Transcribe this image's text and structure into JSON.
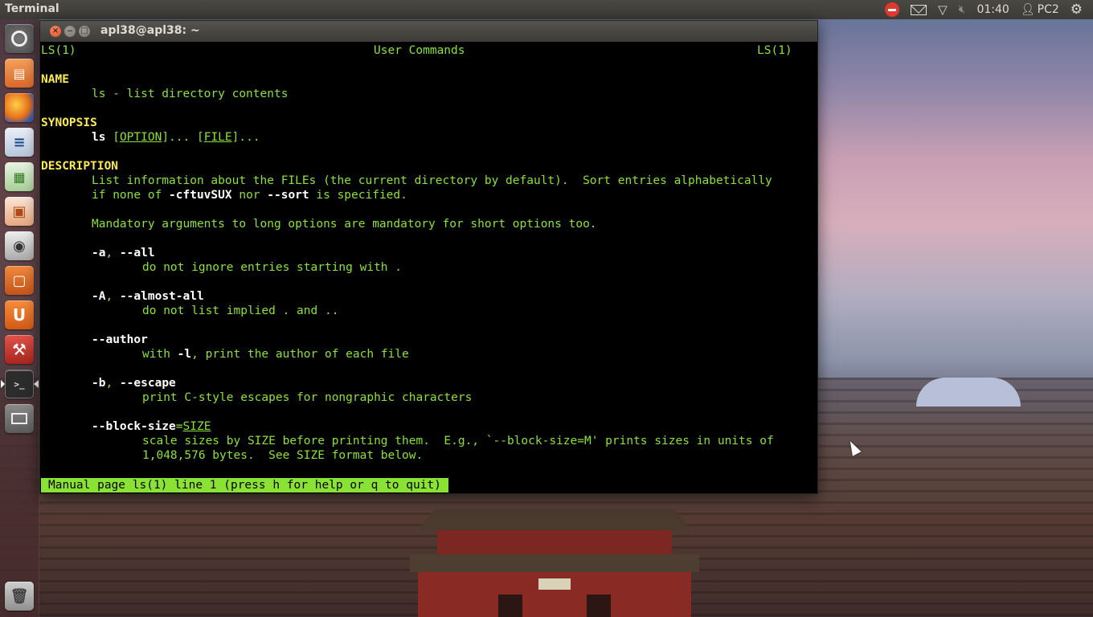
{
  "top_panel": {
    "app_title": "Terminal",
    "clock": "01:40",
    "user": "PC2",
    "icons": [
      "stop-icon",
      "mail-icon",
      "wifi-icon",
      "volume-muted-icon",
      "user-icon",
      "gear-icon"
    ]
  },
  "launcher": {
    "items": [
      {
        "name": "dash",
        "icon": "ubuntu-logo-icon"
      },
      {
        "name": "files",
        "icon": "folder-icon"
      },
      {
        "name": "firefox",
        "icon": "firefox-icon"
      },
      {
        "name": "writer",
        "icon": "libreoffice-writer-icon"
      },
      {
        "name": "calc",
        "icon": "libreoffice-calc-icon"
      },
      {
        "name": "impress",
        "icon": "libreoffice-impress-icon"
      },
      {
        "name": "camera",
        "icon": "camera-icon"
      },
      {
        "name": "software-center",
        "icon": "shopping-bag-icon"
      },
      {
        "name": "ubuntu-one",
        "icon": "ubuntu-one-icon"
      },
      {
        "name": "system-settings",
        "icon": "settings-icon"
      },
      {
        "name": "terminal",
        "icon": "terminal-icon"
      },
      {
        "name": "workspace-switcher",
        "icon": "workspace-icon"
      },
      {
        "name": "trash",
        "icon": "trash-icon"
      }
    ]
  },
  "window": {
    "title": "apl38@apl38: ~"
  },
  "man": {
    "header_left": "LS(1)",
    "header_center": "User Commands",
    "header_right": "LS(1)",
    "name_heading": "NAME",
    "name_text": "ls - list directory contents",
    "synopsis_heading": "SYNOPSIS",
    "synopsis_cmd": "ls",
    "synopsis_opt1_pre": " [",
    "synopsis_option": "OPTION",
    "synopsis_opt1_post": "]... [",
    "synopsis_file": "FILE",
    "synopsis_opt2_post": "]...",
    "description_heading": "DESCRIPTION",
    "desc_line1": "List information about the FILEs (the current directory by default).  Sort entries alphabetically",
    "desc_line2_a": "if none of ",
    "desc_line2_b": "-cftuvSUX",
    "desc_line2_c": " nor ",
    "desc_line2_d": "--sort",
    "desc_line2_e": " is specified.",
    "mandatory": "Mandatory arguments to long options are mandatory for short options too.",
    "opt_a_short": "-a",
    "opt_a_sep": ", ",
    "opt_a_long": "--all",
    "opt_a_desc": "do not ignore entries starting with .",
    "opt_A_short": "-A",
    "opt_A_sep": ", ",
    "opt_A_long": "--almost-all",
    "opt_A_desc": "do not list implied . and ..",
    "opt_author": "--author",
    "opt_author_desc_a": "with ",
    "opt_author_desc_b": "-l",
    "opt_author_desc_c": ", print the author of each file",
    "opt_b_short": "-b",
    "opt_b_sep": ", ",
    "opt_b_long": "--escape",
    "opt_b_desc": "print C-style escapes for nongraphic characters",
    "opt_bs": "--block-size",
    "opt_bs_eq": "=",
    "opt_bs_arg": "SIZE",
    "opt_bs_desc1": "scale sizes by SIZE before printing them.  E.g., `--block-size=M' prints sizes in units of",
    "opt_bs_desc2": "1,048,576 bytes.  See SIZE format below.",
    "status": "Manual page ls(1) line 1 (press h for help or q to quit)"
  }
}
